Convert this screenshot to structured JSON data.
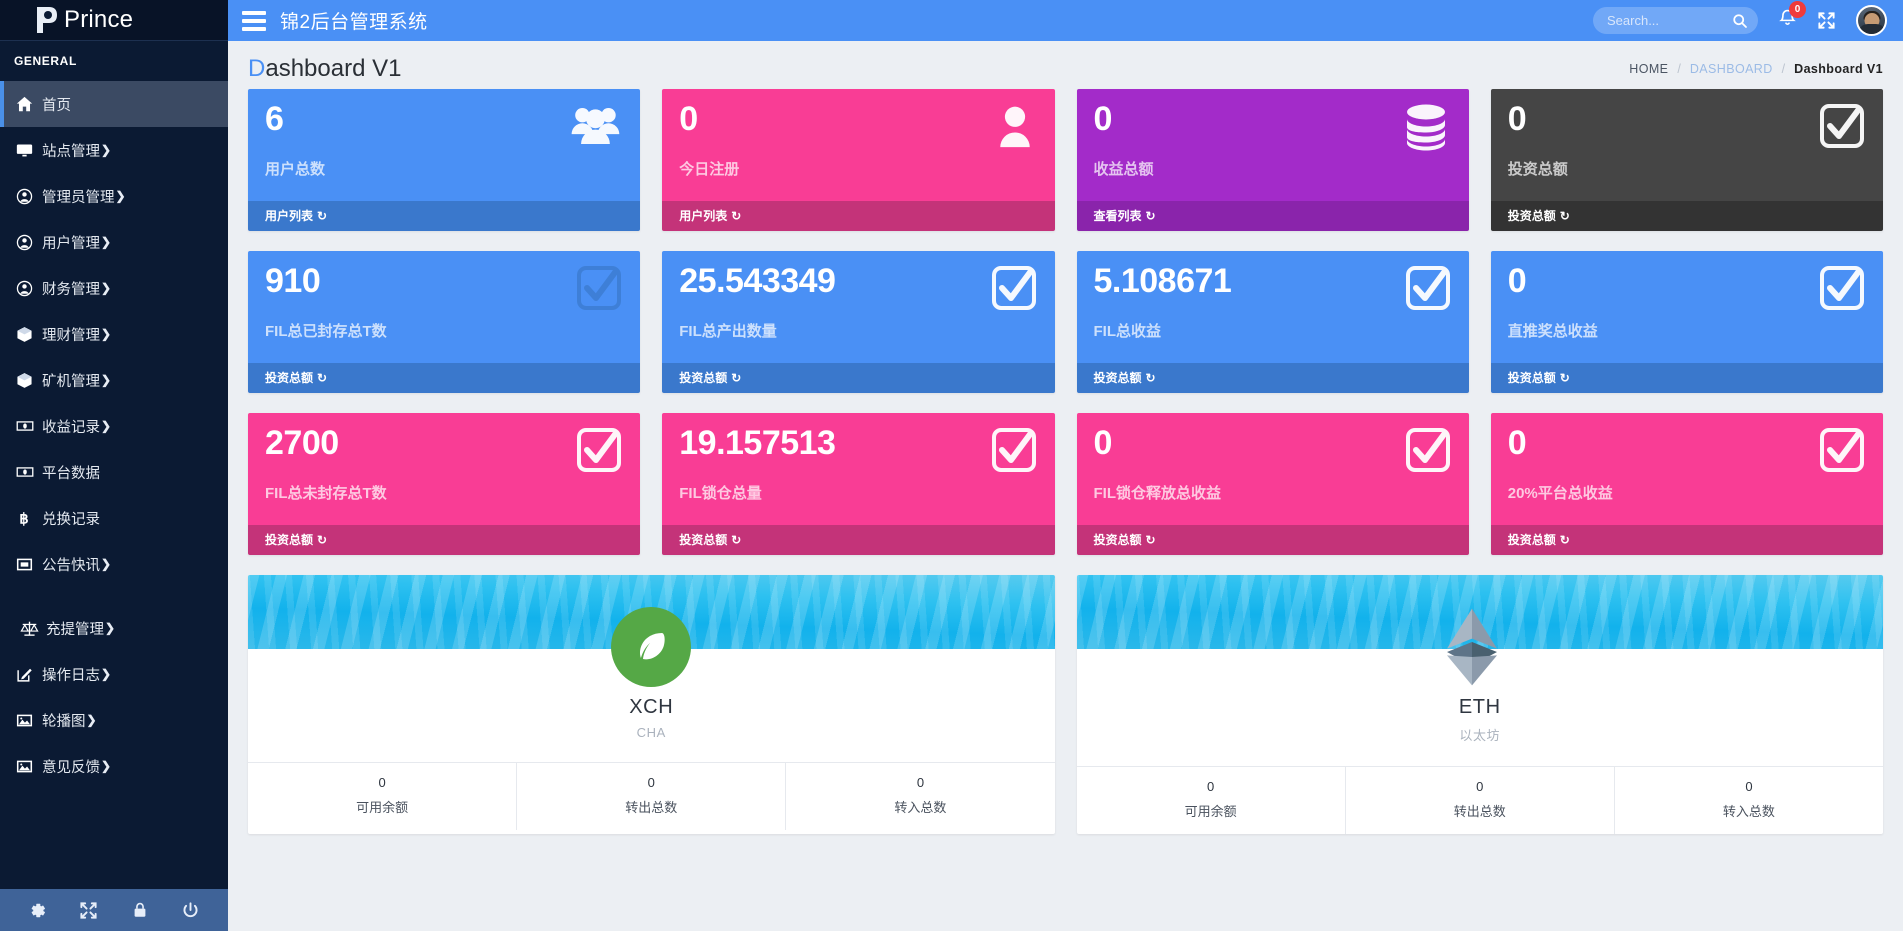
{
  "brand": {
    "name": "Prince",
    "logo_icon": "p-logo-icon"
  },
  "sidebar": {
    "section_label": "GENERAL",
    "items": [
      {
        "label": "首页",
        "icon": "home-icon",
        "caret": "",
        "active": true
      },
      {
        "label": "站点管理",
        "icon": "monitor-icon",
        "caret": "❯",
        "active": false
      },
      {
        "label": "管理员管理",
        "icon": "user-circle-icon",
        "caret": "❯",
        "active": false
      },
      {
        "label": "用户管理",
        "icon": "user-circle-icon",
        "caret": "❯",
        "active": false
      },
      {
        "label": "财务管理",
        "icon": "user-circle-icon",
        "caret": "❯",
        "active": false
      },
      {
        "label": "理财管理",
        "icon": "cube-icon",
        "caret": "❯",
        "active": false
      },
      {
        "label": "矿机管理",
        "icon": "cube-icon",
        "caret": "❯",
        "active": false
      },
      {
        "label": "收益记录",
        "icon": "money-icon",
        "caret": "❯",
        "active": false
      },
      {
        "label": "平台数据",
        "icon": "money-icon",
        "caret": "",
        "active": false
      },
      {
        "label": "兑换记录",
        "icon": "bitcoin-icon",
        "caret": "",
        "active": false
      },
      {
        "label": "公告快讯",
        "icon": "window-icon",
        "caret": "❯",
        "active": false
      },
      {
        "label": "充提管理",
        "icon": "balance-scale-icon",
        "caret": "❯",
        "active": false
      },
      {
        "label": "操作日志",
        "icon": "edit-icon",
        "caret": "❯",
        "active": false
      },
      {
        "label": "轮播图",
        "icon": "image-icon",
        "caret": "❯",
        "active": false
      },
      {
        "label": "意见反馈",
        "icon": "image-icon",
        "caret": "❯",
        "active": false
      }
    ],
    "footer_icons": [
      "gear-icon",
      "shuffle-icon",
      "lock-icon",
      "power-icon"
    ]
  },
  "topbar": {
    "menu_toggle_icon": "hamburger-icon",
    "title": "锦2后台管理系统",
    "search_placeholder": "Search...",
    "search_value": "",
    "search_icon": "search-icon",
    "bell_icon": "bell-icon",
    "bell_badge": "0",
    "expand_icon": "expand-icon",
    "avatar_icon": "avatar"
  },
  "page": {
    "title_first": "D",
    "title_rest": "ashboard V1",
    "breadcrumb": [
      {
        "label": "HOME",
        "type": "plain"
      },
      {
        "label": "DASHBOARD",
        "type": "link"
      },
      {
        "label": "Dashboard V1",
        "type": "current"
      }
    ],
    "breadcrumb_sep": "/"
  },
  "stats": [
    {
      "value": "6",
      "label": "用户总数",
      "footer": "用户列表",
      "icon": "users-icon",
      "theme": "c-blue"
    },
    {
      "value": "0",
      "label": "今日注册",
      "footer": "用户列表",
      "icon": "user-icon",
      "theme": "c-pink"
    },
    {
      "value": "0",
      "label": "收益总额",
      "footer": "查看列表",
      "icon": "database-icon",
      "theme": "c-purple"
    },
    {
      "value": "0",
      "label": "投资总额",
      "footer": "投资总额",
      "icon": "check-box-icon",
      "theme": "c-dark"
    },
    {
      "value": "910",
      "label": "FIL总已封存总T数",
      "footer": "投资总额",
      "icon": "check-box-icon",
      "theme": "c-blue2"
    },
    {
      "value": "25.543349",
      "label": "FIL总产出数量",
      "footer": "投资总额",
      "icon": "check-box-icon",
      "theme": "c-blue"
    },
    {
      "value": "5.108671",
      "label": "FIL总收益",
      "footer": "投资总额",
      "icon": "check-box-icon",
      "theme": "c-blue"
    },
    {
      "value": "0",
      "label": "直推奖总收益",
      "footer": "投资总额",
      "icon": "check-box-icon",
      "theme": "c-blue"
    },
    {
      "value": "2700",
      "label": "FIL总未封存总T数",
      "footer": "投资总额",
      "icon": "check-box-icon",
      "theme": "c-pink"
    },
    {
      "value": "19.157513",
      "label": "FIL锁仓总量",
      "footer": "投资总额",
      "icon": "check-box-icon",
      "theme": "c-pink"
    },
    {
      "value": "0",
      "label": "FIL锁仓释放总收益",
      "footer": "投资总额",
      "icon": "check-box-icon",
      "theme": "c-pink"
    },
    {
      "value": "0",
      "label": "20%平台总收益",
      "footer": "投资总额",
      "icon": "check-box-icon",
      "theme": "c-pink"
    }
  ],
  "card_footer_arrow": "↻",
  "coins": [
    {
      "name": "XCH",
      "sub": "CHA",
      "logo_icon": "chia-leaf-icon",
      "stats": [
        {
          "value": "0",
          "label": "可用余额"
        },
        {
          "value": "0",
          "label": "转出总数"
        },
        {
          "value": "0",
          "label": "转入总数"
        }
      ]
    },
    {
      "name": "ETH",
      "sub": "以太坊",
      "logo_icon": "ethereum-icon",
      "stats": [
        {
          "value": "0",
          "label": "可用余额"
        },
        {
          "value": "0",
          "label": "转出总数"
        },
        {
          "value": "0",
          "label": "转入总数"
        }
      ]
    }
  ],
  "colors": {
    "accent_blue": "#4a90f5",
    "pink": "#f93d95",
    "purple": "#a32bc9",
    "dark": "#454545",
    "sidebar_bg": "#0b1a33",
    "sidebar_footer": "#3f6398",
    "page_bg": "#eceff3"
  }
}
